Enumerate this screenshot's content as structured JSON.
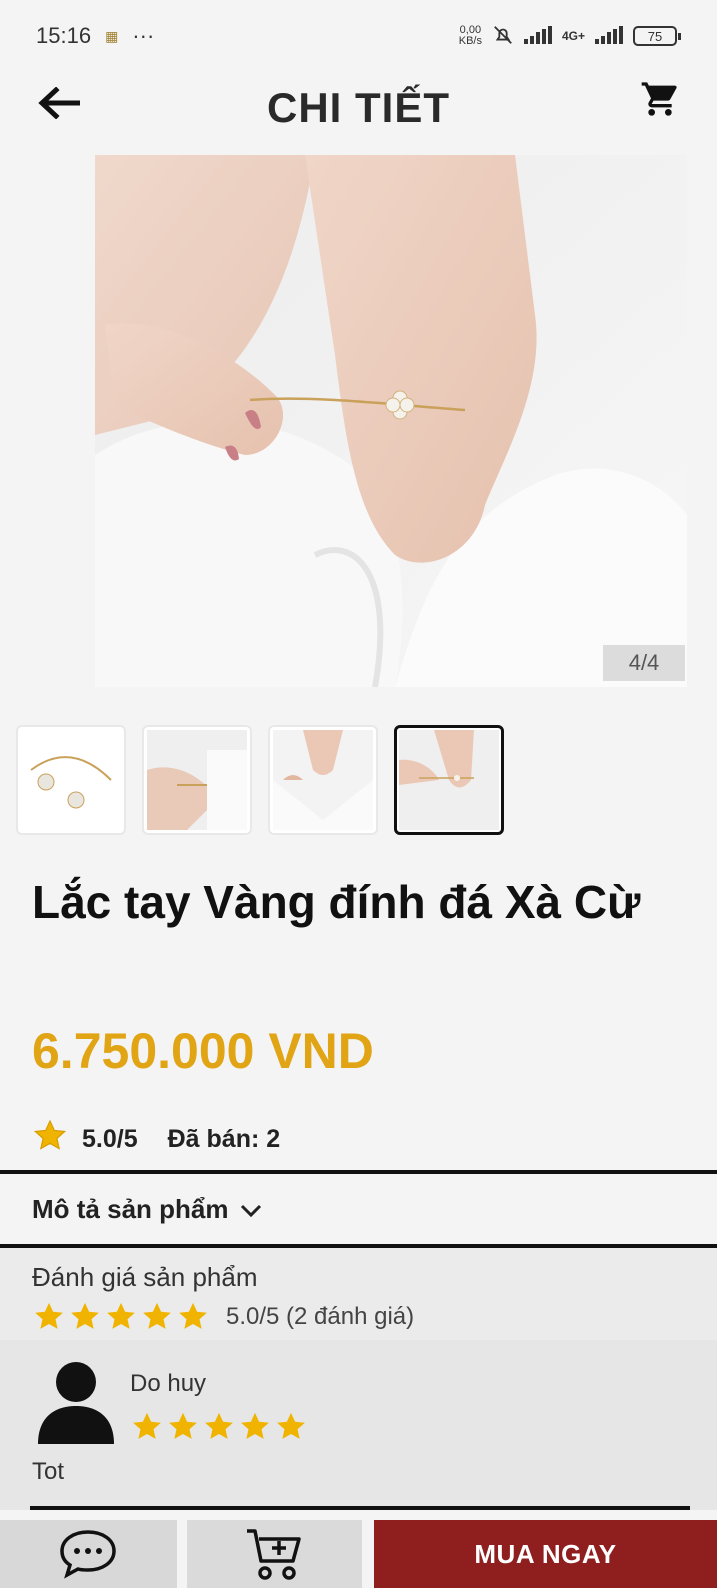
{
  "status_bar": {
    "time": "15:16",
    "more": "···",
    "net_speed_value": "0,00",
    "net_speed_unit": "KB/s",
    "network": "4G+",
    "battery": "75"
  },
  "header": {
    "title": "CHI TIẾT",
    "back_icon": "arrow-left-icon",
    "cart_icon": "shopping-cart-icon"
  },
  "gallery": {
    "counter": "4/4",
    "thumbnail_count": 4,
    "active_index": 3
  },
  "product": {
    "name": "Lắc tay Vàng đính đá Xà Cừ",
    "price": "6.750.000 VND",
    "rating": "5.0/5",
    "sold": "Đã bán: 2"
  },
  "description": {
    "toggle_label": "Mô tả sản phẩm"
  },
  "reviews": {
    "title": "Đánh giá sản phẩm",
    "summary": "5.0/5 (2 đánh giá)",
    "summary_stars": 5,
    "items": [
      {
        "reviewer": "Do huy",
        "stars": 5,
        "text": "Tot"
      }
    ]
  },
  "bottom_bar": {
    "chat_icon": "chat-bubble-icon",
    "add_cart_icon": "cart-plus-icon",
    "buy_now": "MUA NGAY"
  },
  "colors": {
    "price": "#e0a414",
    "star": "#f0b400",
    "buy_button": "#8f1e1e"
  }
}
